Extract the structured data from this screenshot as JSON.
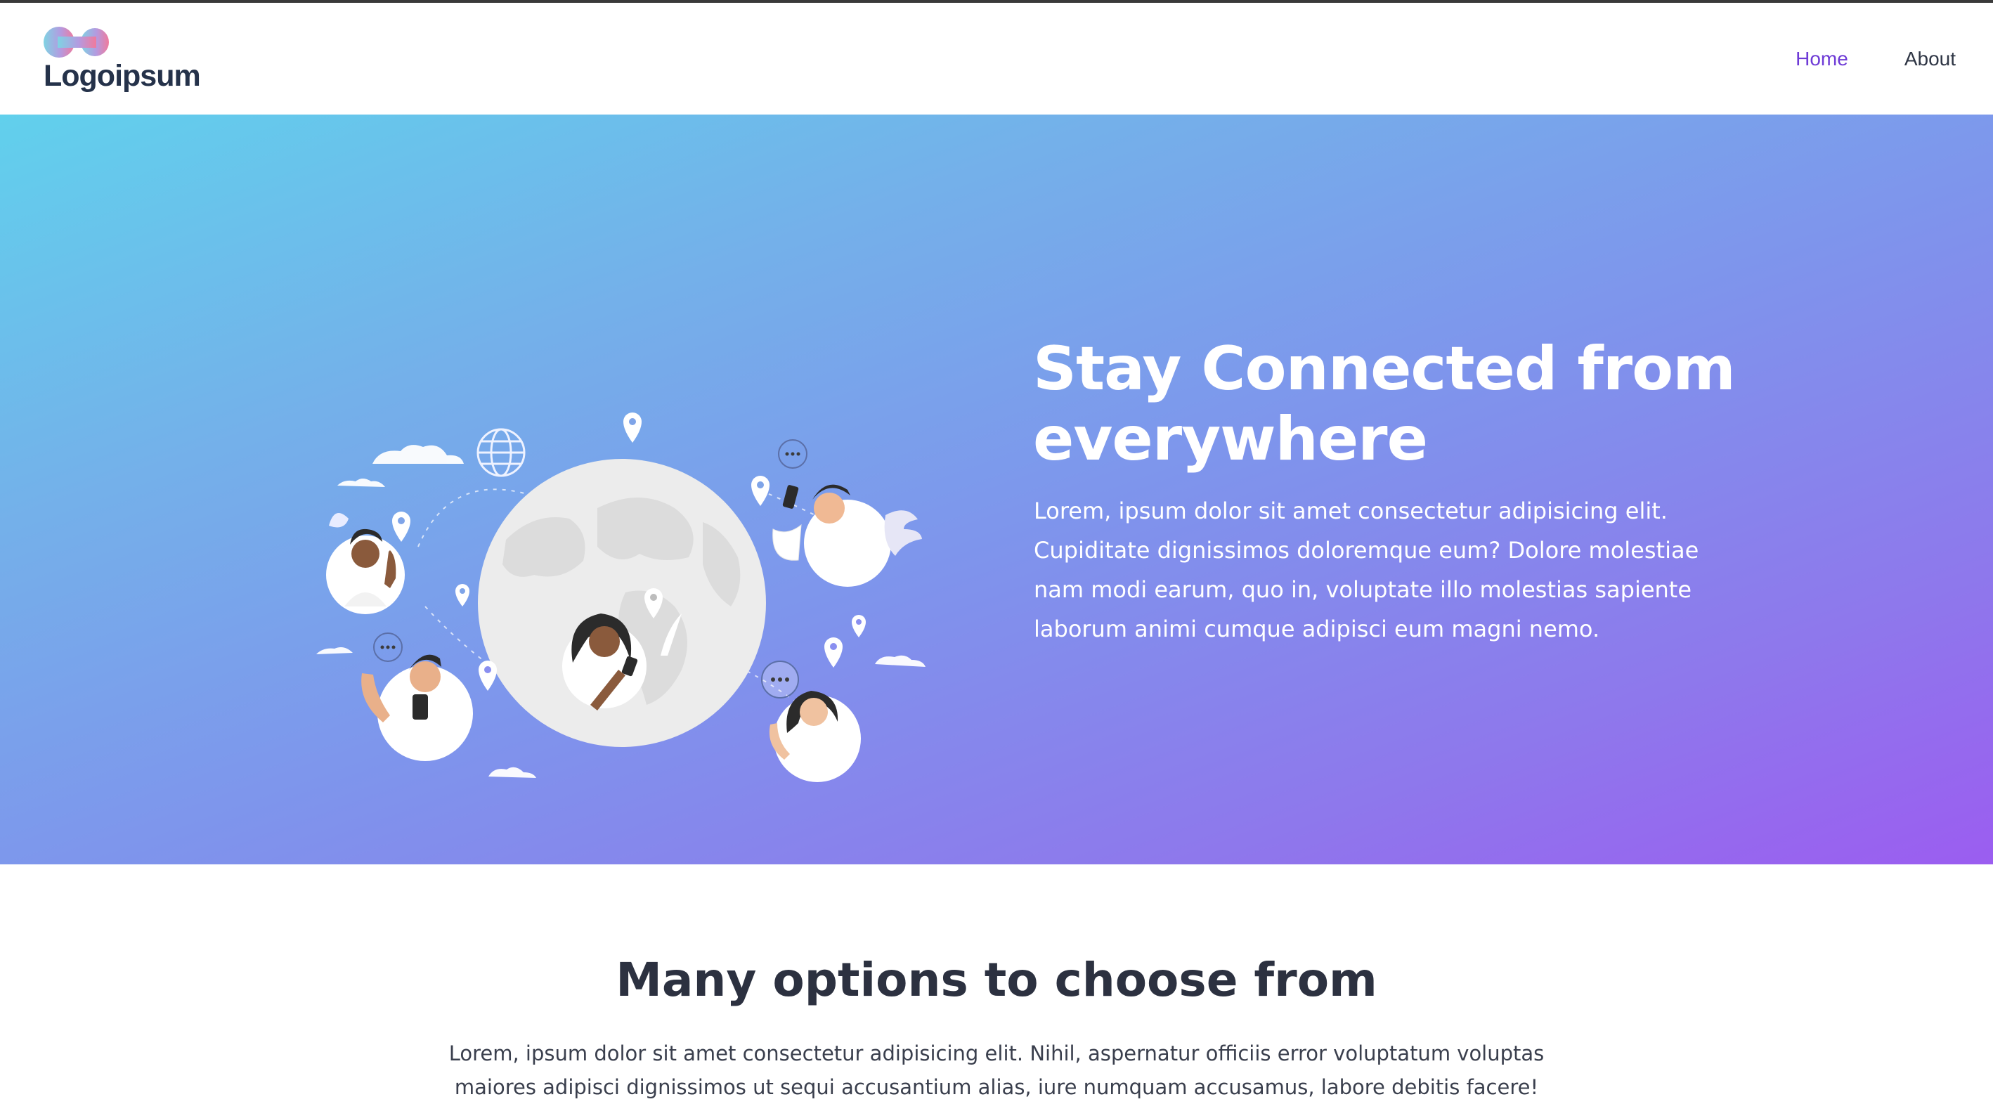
{
  "brand": {
    "logo_text": "Logoipsum"
  },
  "nav": {
    "items": [
      {
        "label": "Home",
        "active": true
      },
      {
        "label": "About",
        "active": false
      }
    ]
  },
  "hero": {
    "title": "Stay Connected from everywhere",
    "text": "Lorem, ipsum dolor sit amet consectetur adipisicing elit. Cupiditate dignissimos doloremque eum? Dolore molestiae nam modi earum, quo in, voluptate illo molestias sapiente laborum animi cumque adipisci eum magni nemo.",
    "illustration": "globe-with-people-illustration"
  },
  "options": {
    "title": "Many options to choose from",
    "text": "Lorem, ipsum dolor sit amet consectetur adipisicing elit. Nihil, aspernatur officiis error voluptatum voluptas maiores adipisci dignissimos ut sequi accusantium alias, iure numquam accusamus, labore debitis facere!"
  },
  "colors": {
    "accent": "#6e3bd6",
    "hero_gradient_start": "#61d0ec",
    "hero_gradient_end": "#9b5df0",
    "heading": "#2c3140",
    "nav_text": "#2f3645"
  }
}
